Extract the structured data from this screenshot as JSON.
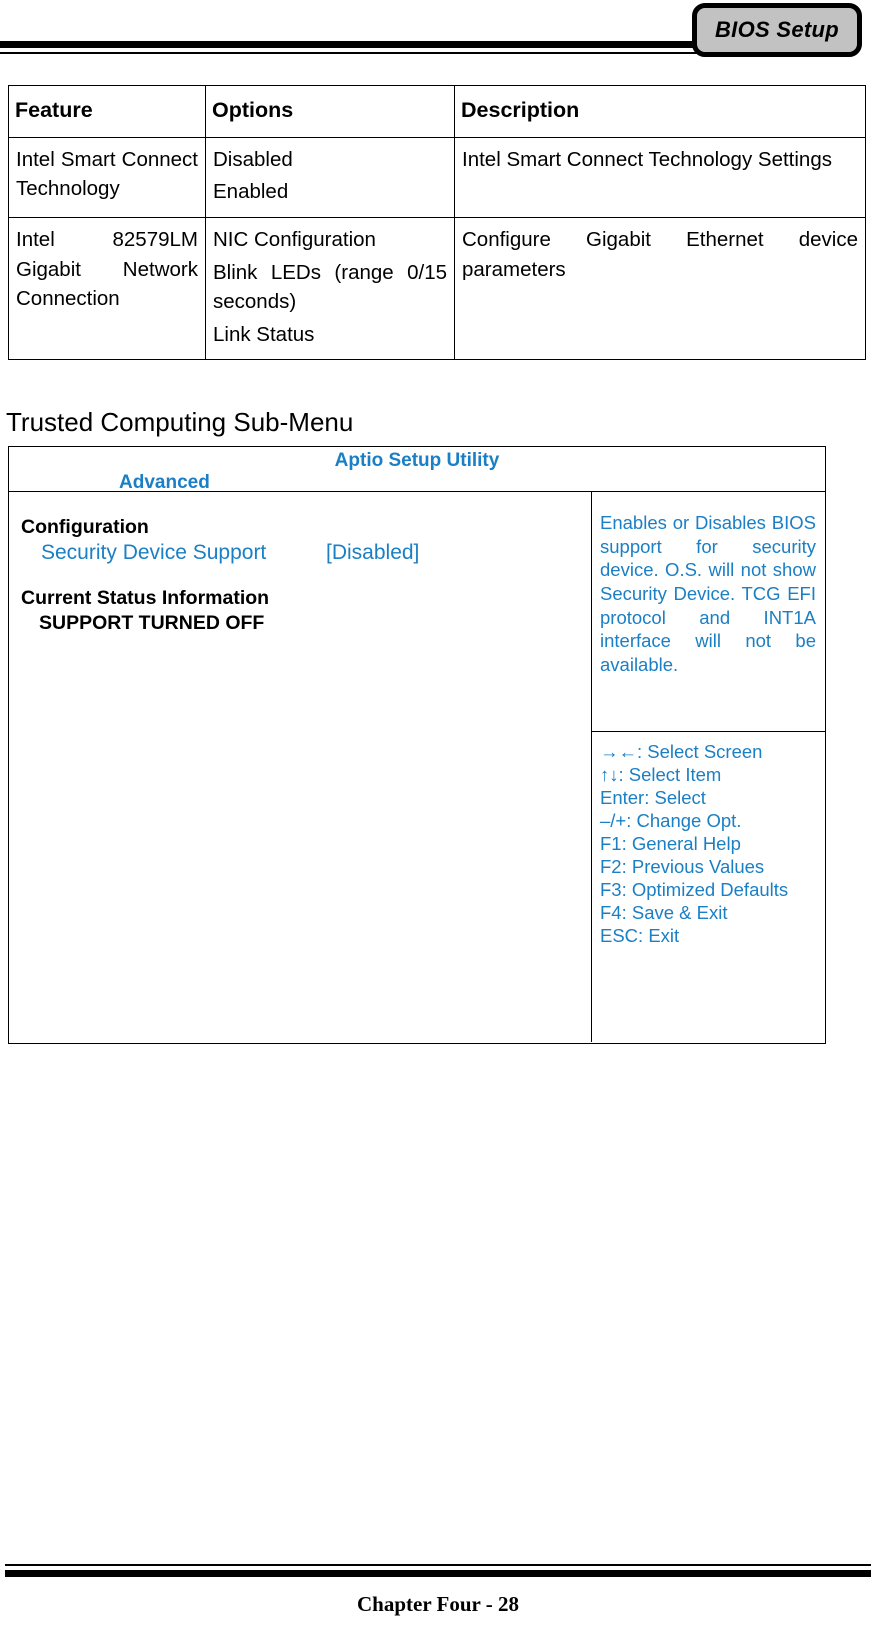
{
  "header": {
    "tab_label": "BIOS Setup"
  },
  "feature_table": {
    "columns": [
      "Feature",
      "Options",
      "Description"
    ],
    "rows": [
      {
        "feature": "Intel Smart Connect Technology",
        "options": [
          "Disabled",
          "Enabled"
        ],
        "description": "Intel Smart Connect Technology Settings"
      },
      {
        "feature": "Intel 82579LM Gigabit Network Connection",
        "options": [
          "NIC Configuration",
          "Blink LEDs (range 0/15 seconds)",
          "Link Status"
        ],
        "description": "Configure Gigabit Ethernet device parameters"
      }
    ]
  },
  "section": {
    "heading": "Trusted Computing Sub-Menu"
  },
  "bios": {
    "utility_title": "Aptio Setup Utility",
    "active_menu": "Advanced",
    "configuration_title": "Configuration",
    "security_device_support_label": "Security Device Support",
    "security_device_support_value": "[Disabled]",
    "current_status_title": "Current Status Information",
    "current_status_value": "SUPPORT TURNED OFF",
    "help_text": "Enables or Disables BIOS support for security device. O.S. will not show Security Device. TCG EFI protocol and INT1A interface will not be available.",
    "key_hints": [
      "→←: Select Screen",
      "↑↓: Select Item",
      "Enter: Select",
      "–/+: Change Opt.",
      "F1: General Help",
      "F2: Previous Values",
      "F3: Optimized Defaults",
      "F4: Save & Exit",
      "ESC: Exit"
    ],
    "accent_color": "#1a7fc4"
  },
  "footer": {
    "page_label": "Chapter Four - 28"
  }
}
